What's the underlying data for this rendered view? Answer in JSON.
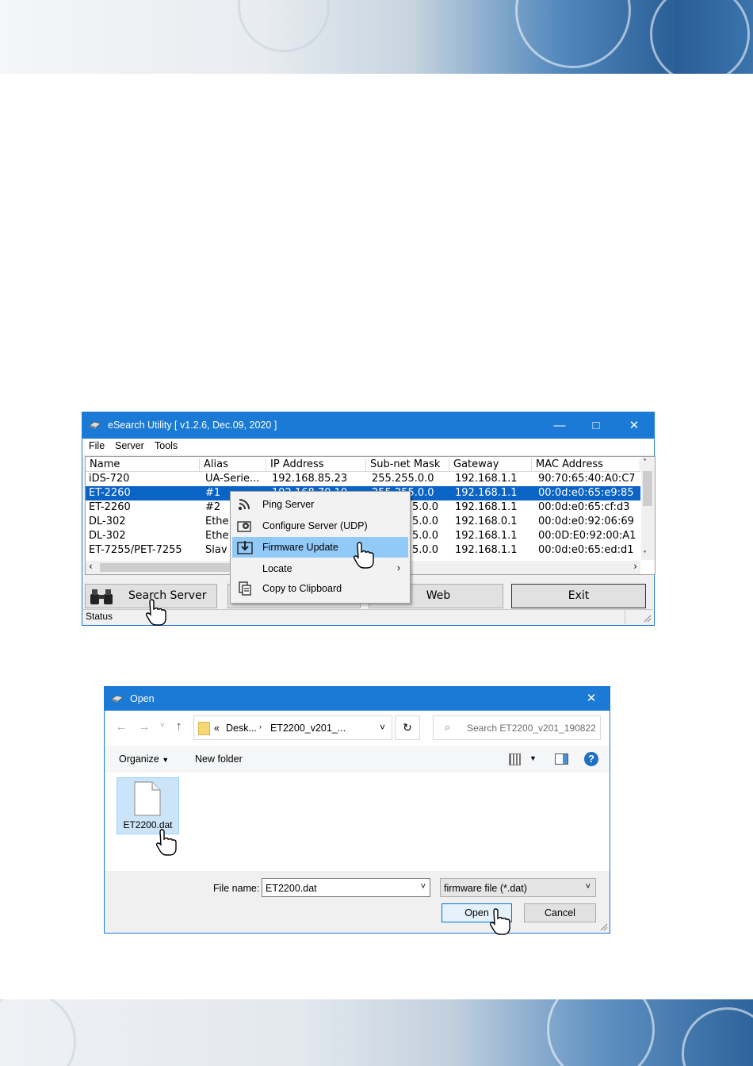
{
  "esearch": {
    "title": "eSearch Utility [ v1.2.6, Dec.09, 2020 ]",
    "menu": [
      "File",
      "Server",
      "Tools"
    ],
    "columns": [
      "Name",
      "Alias",
      "IP Address",
      "Sub-net Mask",
      "Gateway",
      "MAC Address"
    ],
    "rows": [
      {
        "name": "iDS-720",
        "alias": "UA-Serie...",
        "ip": "192.168.85.23",
        "mask": "255.255.0.0",
        "gateway": "192.168.1.1",
        "mac": "90:70:65:40:A0:C7"
      },
      {
        "name": "ET-2260",
        "alias": "#1",
        "ip": "192.168.70.10",
        "mask": "255.255.0.0",
        "gateway": "192.168.1.1",
        "mac": "00:0d:e0:65:e9:85"
      },
      {
        "name": "ET-2260",
        "alias": "#2",
        "ip": "",
        "mask": "5.0.0",
        "gateway": "192.168.1.1",
        "mac": "00:0d:e0:65:cf:d3"
      },
      {
        "name": "DL-302",
        "alias": "Ethe",
        "ip": "",
        "mask": "5.0.0",
        "gateway": "192.168.0.1",
        "mac": "00:0d:e0:92:06:69"
      },
      {
        "name": "DL-302",
        "alias": "Ethe",
        "ip": "",
        "mask": "5.0.0",
        "gateway": "192.168.1.1",
        "mac": "00:0D:E0:92:00:A1"
      },
      {
        "name": "ET-7255/PET-7255",
        "alias": "Slav",
        "ip": "",
        "mask": "5.0.0",
        "gateway": "192.168.1.1",
        "mac": "00:0d:e0:65:ed:d1"
      }
    ],
    "buttons": {
      "search": "Search Server",
      "web": "Web",
      "exit": "Exit"
    },
    "status": "Status",
    "context_menu": [
      "Ping Server",
      "Configure Server (UDP)",
      "Firmware Update",
      "Locate",
      "Copy to Clipboard"
    ]
  },
  "open_dialog": {
    "title": "Open",
    "path": [
      "«",
      "Desk...",
      "ET2200_v201_..."
    ],
    "search_placeholder": "Search ET2200_v201_190822",
    "organize": "Organize",
    "new_folder": "New folder",
    "file": "ET2200.dat",
    "file_name_label": "File name:",
    "file_name_value": "ET2200.dat",
    "filter": "firmware file (*.dat)",
    "open_button": "Open",
    "cancel_button": "Cancel"
  }
}
